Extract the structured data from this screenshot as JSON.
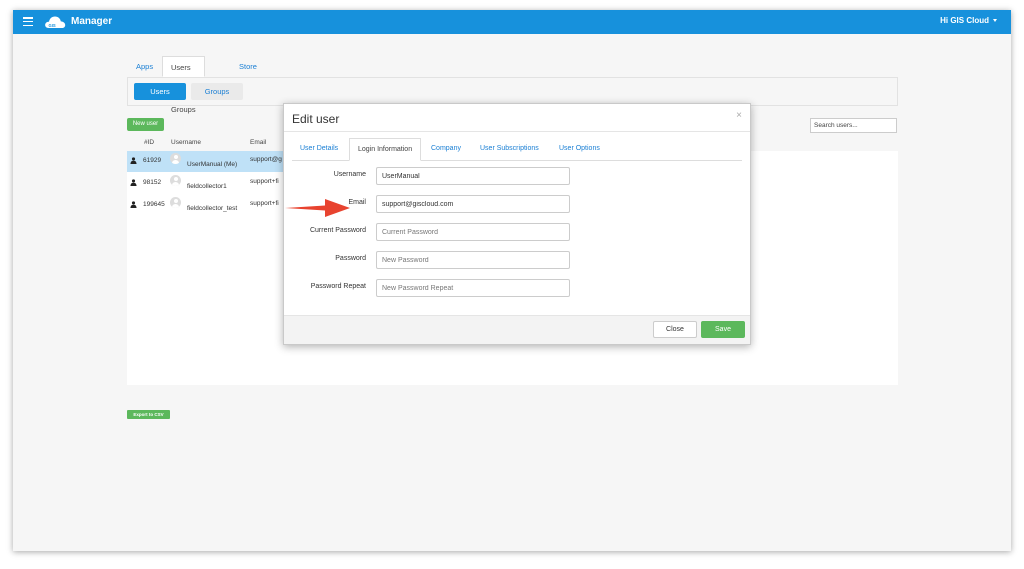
{
  "header": {
    "app_title": "Manager",
    "user_greeting": "Hi GIS Cloud",
    "brand_color": "#1791dc",
    "logo_text": "GIS"
  },
  "main_tabs": [
    {
      "label": "Apps",
      "active": false
    },
    {
      "label": "Users & Groups",
      "active": true
    },
    {
      "label": "Store",
      "active": false
    }
  ],
  "sub_tabs": {
    "users": "Users",
    "groups": "Groups"
  },
  "toolbar": {
    "new_user": "New user",
    "search_placeholder": "Search users..."
  },
  "table": {
    "columns": [
      "#ID",
      "Username",
      "Email"
    ],
    "rows": [
      {
        "id": "61929",
        "username": "UserManual (Me)",
        "email": "support@g",
        "selected": true
      },
      {
        "id": "98152",
        "username": "fieldcollector1",
        "email": "support+fi",
        "selected": false
      },
      {
        "id": "199645",
        "username": "fieldcollector_test",
        "email": "support+fi",
        "selected": false
      }
    ]
  },
  "export_label": "Export to CSV",
  "modal": {
    "title": "Edit user",
    "close_glyph": "×",
    "tabs": [
      {
        "label": "User Details",
        "active": false
      },
      {
        "label": "Login Information",
        "active": true
      },
      {
        "label": "Company",
        "active": false
      },
      {
        "label": "User Subscriptions",
        "active": false
      },
      {
        "label": "User Options",
        "active": false
      }
    ],
    "fields": [
      {
        "label": "Username",
        "value": "UserManual",
        "placeholder": ""
      },
      {
        "label": "Email",
        "value": "support@giscloud.com",
        "placeholder": ""
      },
      {
        "label": "Current Password",
        "value": "",
        "placeholder": "Current Password"
      },
      {
        "label": "Password",
        "value": "",
        "placeholder": "New Password"
      },
      {
        "label": "Password Repeat",
        "value": "",
        "placeholder": "New Password Repeat"
      }
    ],
    "close_label": "Close",
    "save_label": "Save"
  },
  "colors": {
    "accent": "#1791dc",
    "success": "#5cb85c",
    "annotation_arrow": "#e8432f",
    "selected_row": "#bfe1f7"
  }
}
